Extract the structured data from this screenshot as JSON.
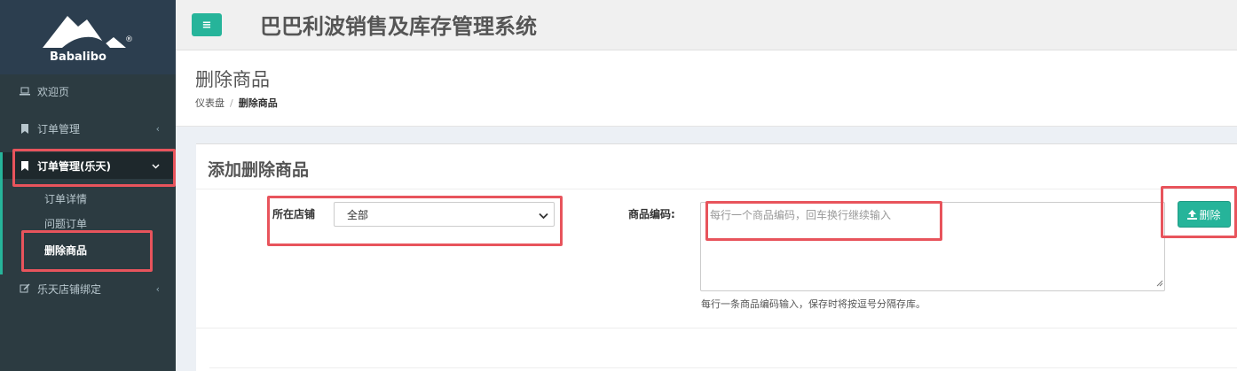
{
  "brand": {
    "name": "Babalibo",
    "reg": "®"
  },
  "sidebar": {
    "items": [
      {
        "label": "欢迎页",
        "icon": "laptop-icon"
      },
      {
        "label": "订单管理",
        "icon": "bookmark-icon",
        "chevron": "‹"
      },
      {
        "label": "订单管理(乐天)",
        "icon": "bookmark-icon",
        "chevron": "⌄"
      },
      {
        "label": "乐天店铺绑定",
        "icon": "edit-icon",
        "chevron": "‹"
      }
    ],
    "sub_items": [
      {
        "label": "订单详情"
      },
      {
        "label": "问题订单"
      },
      {
        "label": "删除商品"
      }
    ]
  },
  "header": {
    "menu_icon": "≡",
    "title": "巴巴利波销售及库存管理系统"
  },
  "page": {
    "title": "删除商品",
    "breadcrumb": {
      "home": "仪表盘",
      "sep": "/",
      "current": "删除商品"
    }
  },
  "form": {
    "box_title": "添加删除商品",
    "store_label": "所在店铺",
    "store_value": "全部",
    "code_label": "商品编码:",
    "code_placeholder": "每行一个商品编码，回车换行继续输入",
    "help_text": "每行一条商品编码输入，保存时将按逗号分隔存库。",
    "delete_button": "删除"
  },
  "colors": {
    "accent": "#26b49a",
    "sidebar_bg": "#2c3b41",
    "highlight": "#e8545c"
  }
}
